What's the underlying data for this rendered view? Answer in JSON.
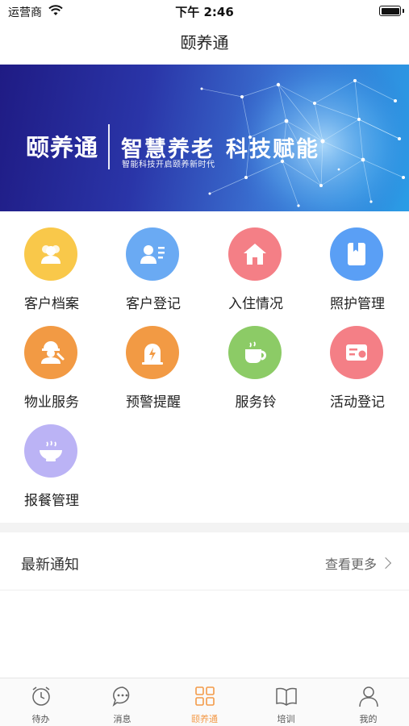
{
  "status_bar": {
    "carrier": "运营商",
    "time": "下午 2:46"
  },
  "nav": {
    "title": "颐养通"
  },
  "banner": {
    "logo": "颐养通",
    "headline_1": "智慧养老",
    "headline_2": "科技赋能",
    "subtitle": "智能科技开启颐养新时代"
  },
  "grid": {
    "items": [
      {
        "label": "客户档案",
        "icon": "people-icon",
        "color": "#f9c84a"
      },
      {
        "label": "客户登记",
        "icon": "id-card-icon",
        "color": "#6aaaf3"
      },
      {
        "label": "入住情况",
        "icon": "home-icon",
        "color": "#f47f86"
      },
      {
        "label": "照护管理",
        "icon": "book-icon",
        "color": "#5a9ff5"
      },
      {
        "label": "物业服务",
        "icon": "worker-icon",
        "color": "#f29a44"
      },
      {
        "label": "预警提醒",
        "icon": "alarm-icon",
        "color": "#f29a44"
      },
      {
        "label": "服务铃",
        "icon": "cup-icon",
        "color": "#8ccb66"
      },
      {
        "label": "活动登记",
        "icon": "ticket-icon",
        "color": "#f47f86"
      },
      {
        "label": "报餐管理",
        "icon": "bowl-icon",
        "color": "#bbb3f5"
      }
    ]
  },
  "notice": {
    "title": "最新通知",
    "more": "查看更多"
  },
  "tabs": [
    {
      "label": "待办",
      "icon": "alarm-clock-icon"
    },
    {
      "label": "消息",
      "icon": "chat-bubble-icon"
    },
    {
      "label": "颐养通",
      "icon": "grid-icon",
      "active": true,
      "color": "#f39a48"
    },
    {
      "label": "培训",
      "icon": "open-book-icon"
    },
    {
      "label": "我的",
      "icon": "user-icon"
    }
  ]
}
